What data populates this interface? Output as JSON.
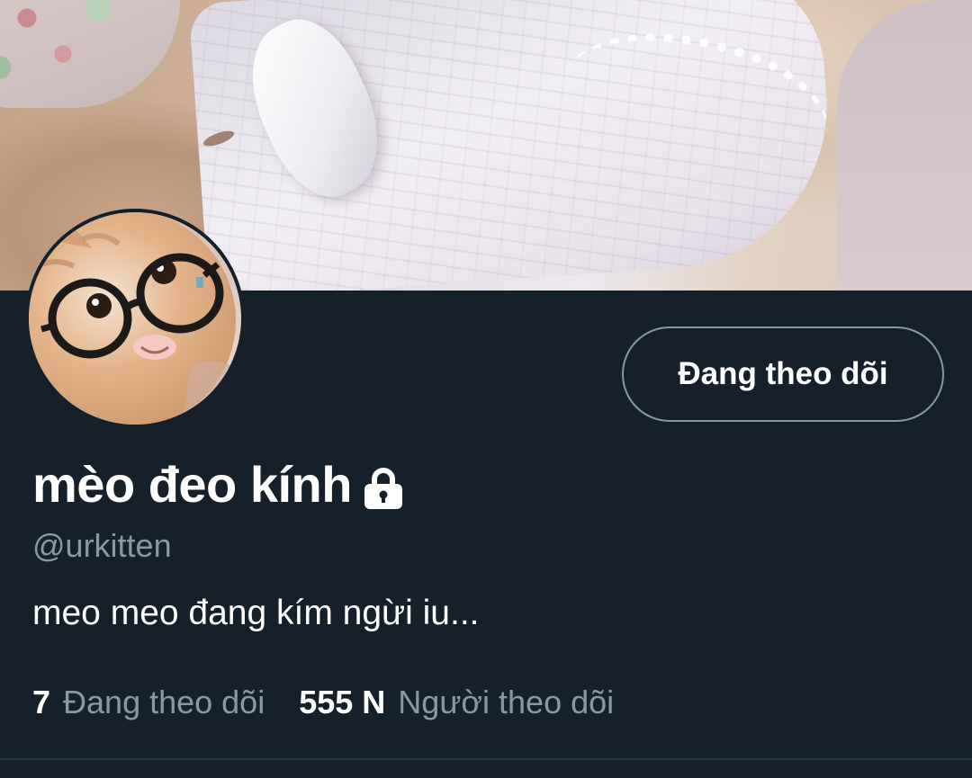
{
  "profile": {
    "display_name": "mèo đeo kính",
    "handle": "@urkitten",
    "bio": "meo meo đang kím ngừi iu...",
    "protected_icon": "lock-icon"
  },
  "actions": {
    "follow_button_label": "Đang theo dõi"
  },
  "stats": {
    "following_count": "7",
    "following_label": "Đang theo dõi",
    "followers_count": "555 N",
    "followers_label": "Người theo dõi"
  },
  "colors": {
    "background": "#15202b",
    "secondary_text": "#8899a6",
    "divider": "#243447"
  }
}
